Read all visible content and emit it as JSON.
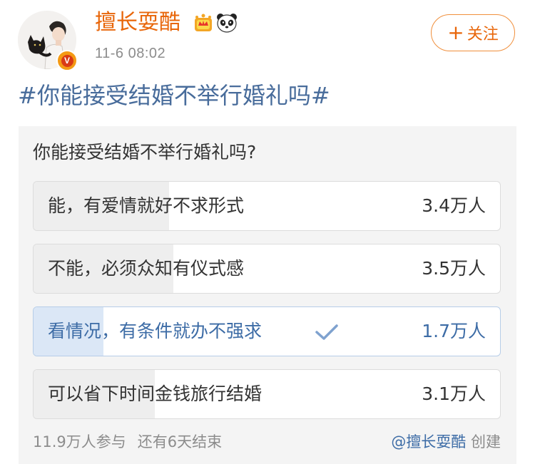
{
  "post": {
    "author": "擅长耍酷",
    "timestamp": "11-6 08:02",
    "verified_badge": "V",
    "follow_label": "关注",
    "follow_plus": "+",
    "topic": "#你能接受结婚不举行婚礼吗#"
  },
  "poll": {
    "question": "你能接受结婚不举行婚礼吗?",
    "options": [
      {
        "label": "能，有爱情就好不求形式",
        "count": "3.4万人",
        "share": 0.29,
        "selected": false
      },
      {
        "label": "不能，必须众知有仪式感",
        "count": "3.5万人",
        "share": 0.3,
        "selected": false
      },
      {
        "label": "看情况，有条件就办不强求",
        "count": "1.7万人",
        "share": 0.15,
        "selected": true
      },
      {
        "label": "可以省下时间金钱旅行结婚",
        "count": "3.1万人",
        "share": 0.26,
        "selected": false
      }
    ],
    "participants": "11.9万人参与",
    "remaining": "还有6天结束",
    "creator": "@擅长耍酷",
    "created_label": "创建"
  },
  "icons": [
    "avatar-cat-image",
    "verified-icon",
    "crown-icon",
    "panda-icon",
    "check-icon"
  ],
  "colors": {
    "author": "#e8660a",
    "topic": "#486c9b",
    "selected": "#3d6ca6",
    "selected_fill": "#dbe7f6",
    "fill": "#eeeeee",
    "card_bg": "#f4f4f4"
  }
}
